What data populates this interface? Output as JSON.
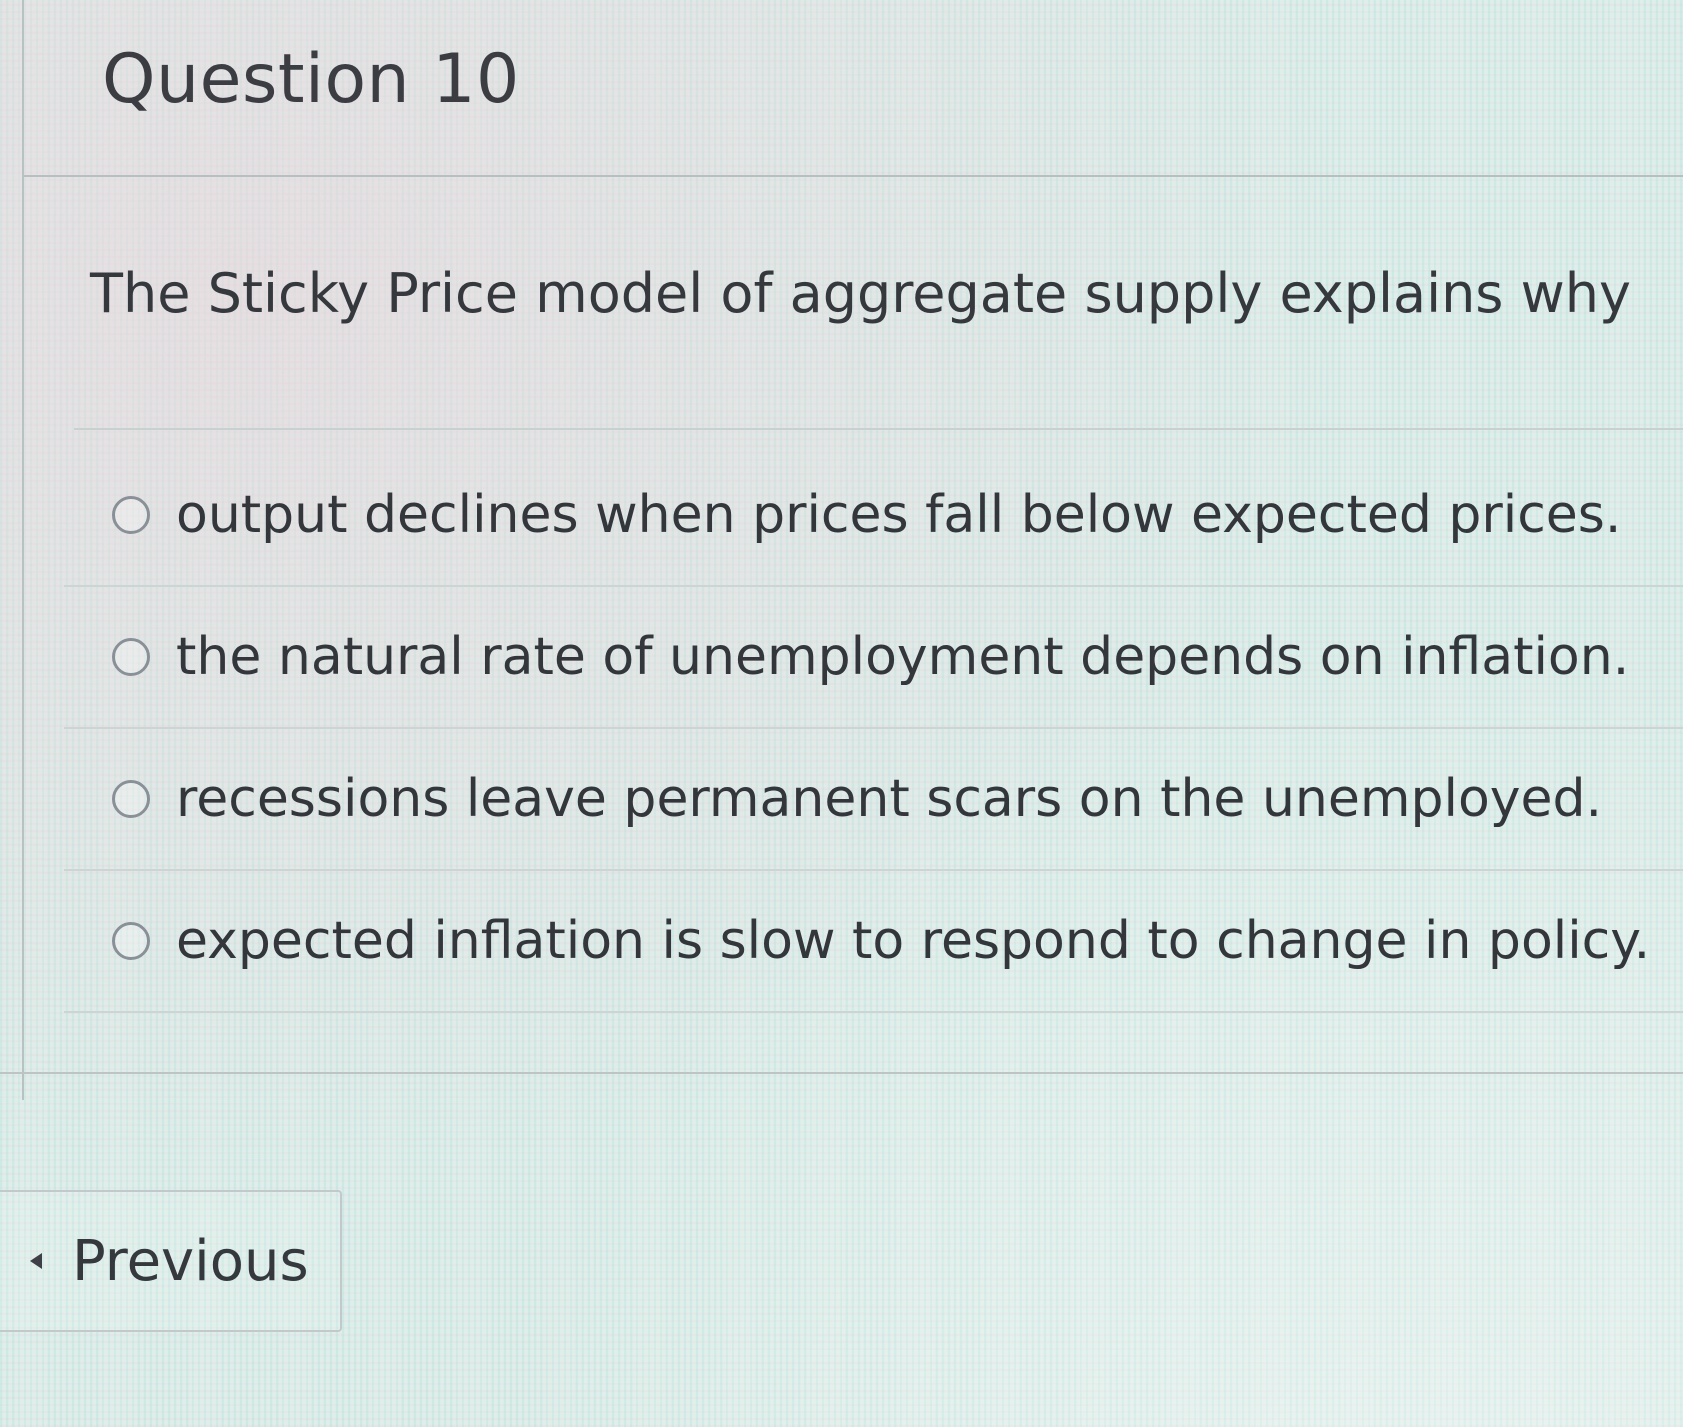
{
  "header": {
    "title": "Question 10"
  },
  "question": {
    "text": "The Sticky Price model of aggregate supply explains why",
    "answers": [
      {
        "label": "output declines when prices fall below expected prices."
      },
      {
        "label": "the natural rate of unemployment depends on inflation."
      },
      {
        "label": "recessions leave permanent scars on the unemployed."
      },
      {
        "label": "expected inflation is slow to respond to change in policy."
      }
    ]
  },
  "navigation": {
    "previous_label": "Previous"
  },
  "icons": {
    "radio": "radio-unselected-icon",
    "previous": "caret-left-icon"
  }
}
